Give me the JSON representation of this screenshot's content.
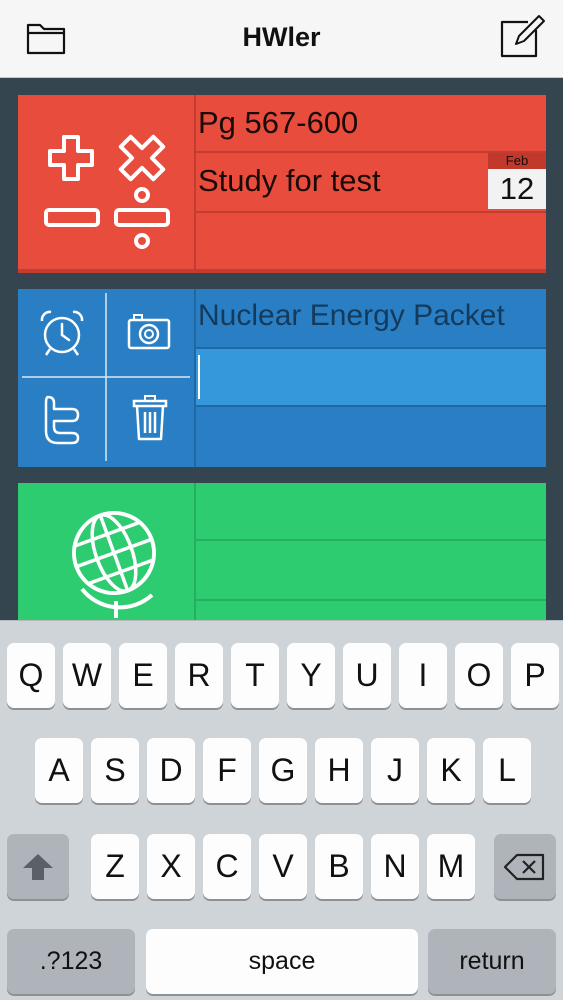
{
  "navbar": {
    "title": "HWler",
    "left_icon": "folder-icon",
    "right_icon": "compose-icon"
  },
  "cards": {
    "red": {
      "color": "#e84c3d",
      "icon": "math-operators-icon",
      "rows": [
        "Pg 567-600",
        "Study for test",
        ""
      ],
      "due": {
        "month": "Feb",
        "day": "12"
      }
    },
    "blue": {
      "color": "#2a7fc4",
      "actions": [
        "alarm-clock-icon",
        "camera-icon",
        "twitter-icon",
        "trash-icon"
      ],
      "rows": [
        "Nuclear Energy Packet",
        "",
        ""
      ]
    },
    "green": {
      "color": "#2ecc71",
      "icon": "globe-icon",
      "rows": [
        "",
        "",
        ""
      ]
    }
  },
  "keyboard": {
    "row1": [
      "Q",
      "W",
      "E",
      "R",
      "T",
      "Y",
      "U",
      "I",
      "O",
      "P"
    ],
    "row2": [
      "A",
      "S",
      "D",
      "F",
      "G",
      "H",
      "J",
      "K",
      "L"
    ],
    "row3": [
      "Z",
      "X",
      "C",
      "V",
      "B",
      "N",
      "M"
    ],
    "numbers_label": ".?123",
    "space_label": "space",
    "return_label": "return"
  }
}
